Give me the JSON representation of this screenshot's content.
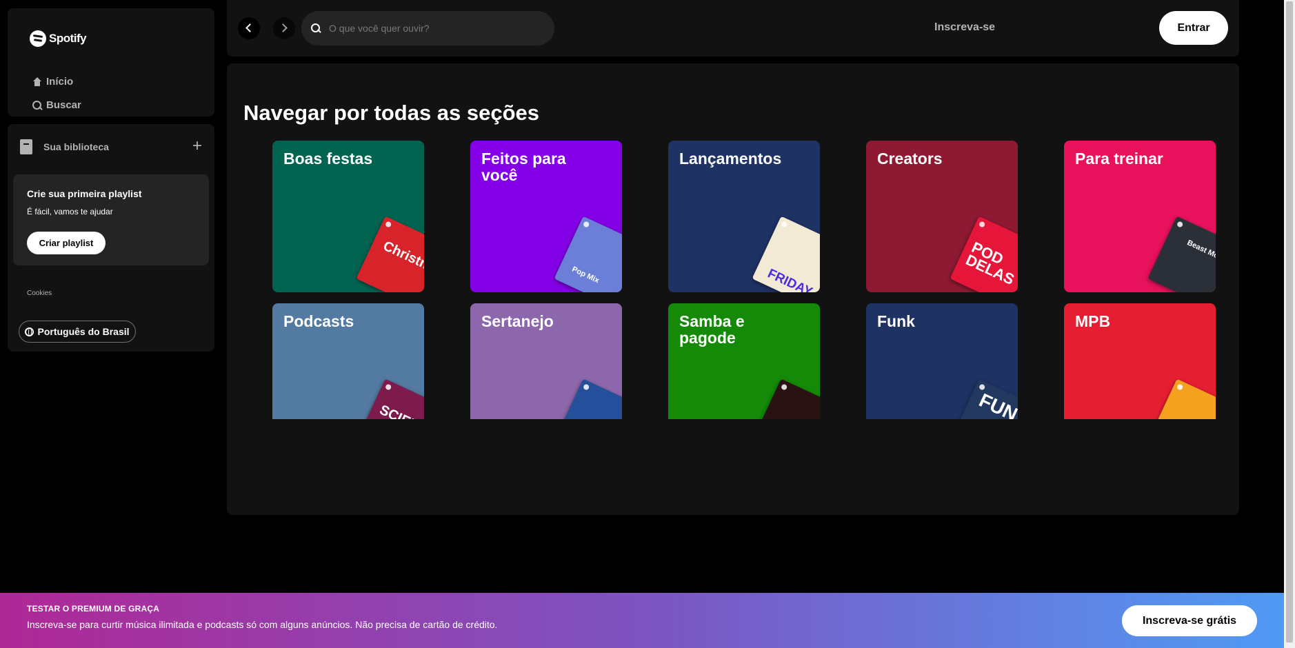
{
  "sidebar": {
    "logo": "Spotify",
    "nav": {
      "home": "Início",
      "search": "Buscar"
    },
    "library": {
      "title": "Sua biblioteca",
      "add_label": "+",
      "card_title": "Crie sua primeira playlist",
      "card_subtitle": "É fácil, vamos te ajudar",
      "create_button": "Criar playlist"
    },
    "cookies": "Cookies",
    "language": "Português do Brasil"
  },
  "topbar": {
    "search_placeholder": "O que você quer ouvir?",
    "signup": "Inscreva-se",
    "login": "Entrar"
  },
  "main": {
    "title": "Navegar por todas as seções",
    "categories": [
      {
        "title": "Boas festas",
        "color": "#006450",
        "art_color": "#d8232a",
        "art_text": "Christmas Hits"
      },
      {
        "title": "Feitos para você",
        "color": "#8400e7",
        "art_color": "#6c7fd8",
        "art_text": "Pop Mix"
      },
      {
        "title": "Lançamentos",
        "color": "#1e3264",
        "art_color": "#f3ead5",
        "art_text": "FRIDAY"
      },
      {
        "title": "Creators",
        "color": "#8d1932",
        "art_color": "#e6163b",
        "art_text": "POD DELAS"
      },
      {
        "title": "Para treinar",
        "color": "#e8115b",
        "art_color": "#2b2f38",
        "art_text": "Beast Mode"
      },
      {
        "title": "Podcasts",
        "color": "#537aa1",
        "art_color": "#7d1b4d",
        "art_text": "SCIENCE"
      },
      {
        "title": "Sertanejo",
        "color": "#8d67ab",
        "art_color": "#254f9a",
        "art_text": ""
      },
      {
        "title": "Samba e pagode",
        "color": "#148a08",
        "art_color": "#2a1114",
        "art_text": ""
      },
      {
        "title": "Funk",
        "color": "#1e3264",
        "art_color": "#23385f",
        "art_text": "FUN"
      },
      {
        "title": "MPB",
        "color": "#e61e32",
        "art_color": "#f4a11d",
        "art_text": ""
      }
    ]
  },
  "banner": {
    "kicker": "TESTAR O PREMIUM DE GRAÇA",
    "text": "Inscreva-se para curtir música ilimitada e podcasts só com alguns anúncios. Não precisa de cartão de crédito.",
    "button": "Inscreva-se grátis"
  }
}
